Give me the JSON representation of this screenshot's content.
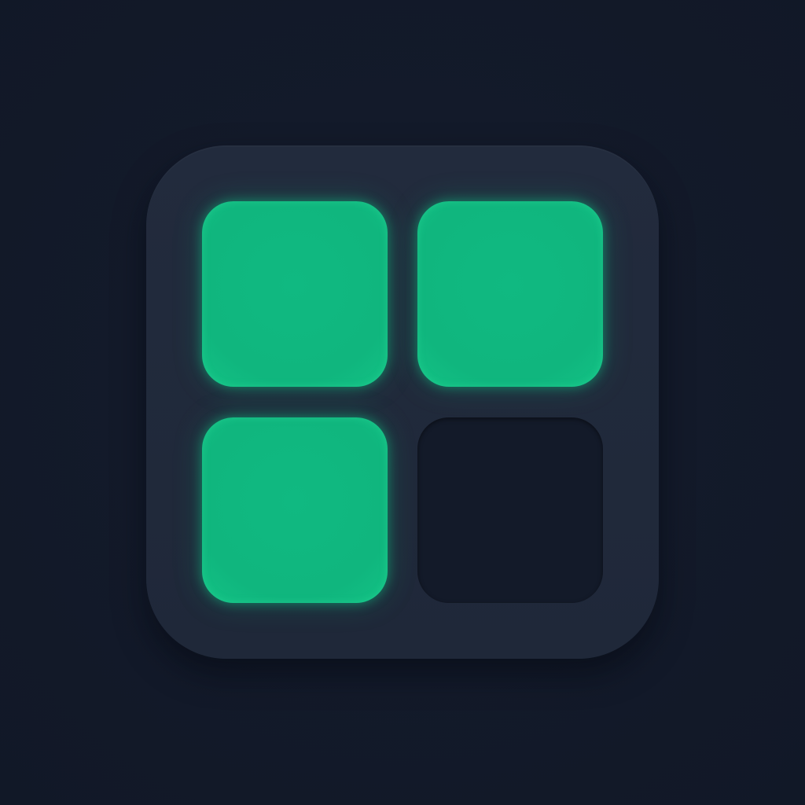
{
  "icon": {
    "name": "four-tile-grid-icon",
    "background_color": "#111827",
    "frame_color": "#222b3d",
    "tiles": [
      {
        "state": "active",
        "color": "#10b981"
      },
      {
        "state": "active",
        "color": "#10b981"
      },
      {
        "state": "active",
        "color": "#10b981"
      },
      {
        "state": "inactive",
        "color": "#131a29"
      }
    ]
  }
}
